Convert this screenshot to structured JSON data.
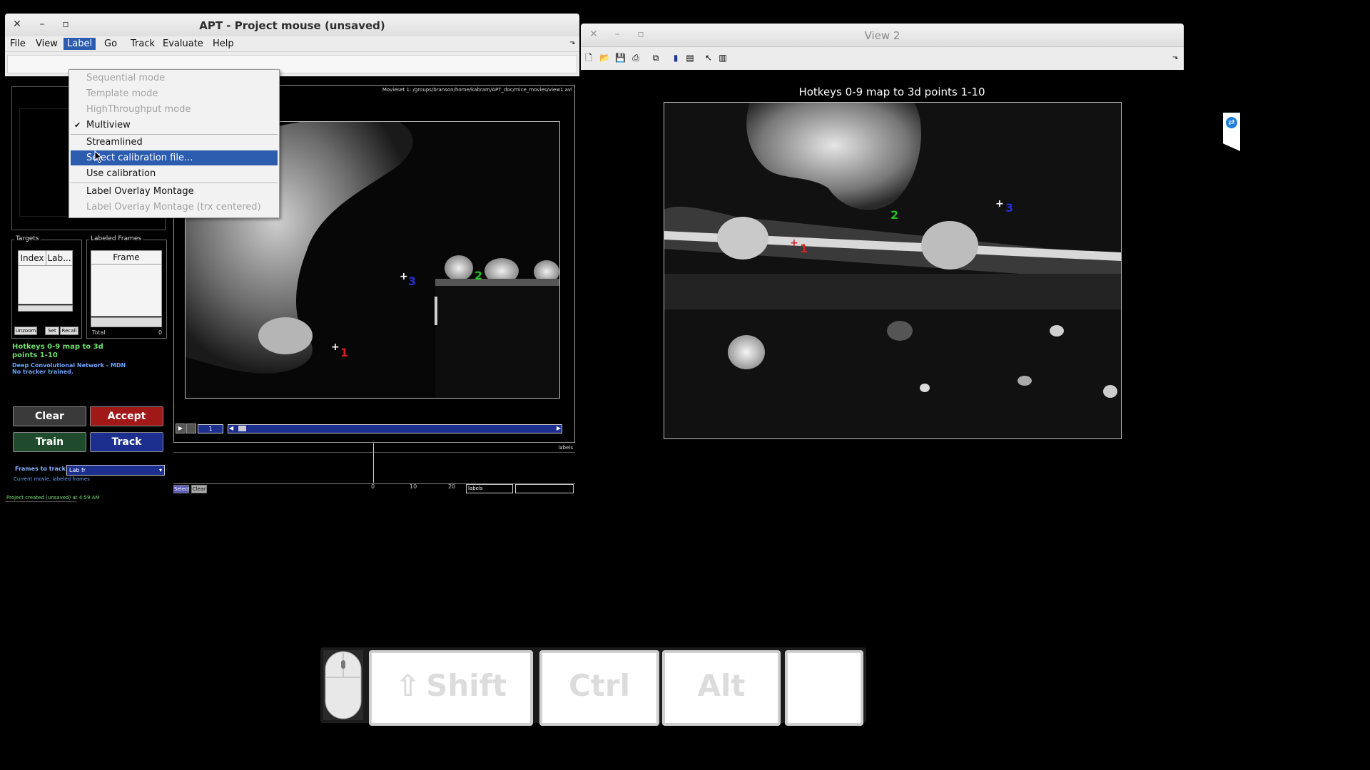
{
  "window1": {
    "title": "APT - Project mouse (unsaved)",
    "menu": [
      "File",
      "View",
      "Label",
      "Go",
      "Track",
      "Evaluate",
      "Help"
    ],
    "active_menu": "Label"
  },
  "label_menu": {
    "items": [
      {
        "label": "Sequential mode",
        "state": "disabled"
      },
      {
        "label": "Template mode",
        "state": "disabled"
      },
      {
        "label": "HighThroughput mode",
        "state": "disabled"
      },
      {
        "label": "Multiview",
        "state": "checked"
      },
      {
        "label": "Streamlined",
        "state": "normal"
      },
      {
        "label": "Select calibration file...",
        "state": "highlighted"
      },
      {
        "label": "Use calibration",
        "state": "normal"
      },
      {
        "label": "Label Overlay Montage",
        "state": "normal"
      },
      {
        "label": "Label Overlay Montage (trx centered)",
        "state": "disabled"
      }
    ],
    "checkmark": "✔"
  },
  "left_panel": {
    "targets_label": "Targets",
    "targets_columns": [
      "Index",
      "Lab..."
    ],
    "target_buttons": [
      "Unzoom",
      "Set",
      "Recall"
    ],
    "labeled_frames_label": "Labeled Frames",
    "labeled_frames_column": "Frame",
    "total_label": "Total",
    "total_value": "0",
    "hotkeys_text_line1": "Hotkeys 0-9 map to 3d",
    "hotkeys_text_line2": "points 1-10",
    "tracker_line1": "Deep Convolutional Network - MDN",
    "tracker_line2": "No tracker trained.",
    "buttons": {
      "clear": "Clear",
      "accept": "Accept",
      "train": "Train",
      "track": "Track"
    },
    "frames_to_track_label": "Frames to track:",
    "frames_to_track_value": "Lab fr",
    "frames_to_track_desc": "Current movie, labeled frames",
    "colors": {
      "clear": "#3a3a3a",
      "accept": "#a01818",
      "train": "#1f4a2b",
      "track": "#1c2f8f"
    }
  },
  "view1": {
    "movie_path": "Movieset 1: /groups/branson/home/kabram/APT_doc/mice_movies/view1.avi",
    "frame_value": "1",
    "landmarks": [
      {
        "num": "1",
        "color": "#d22020"
      },
      {
        "num": "2",
        "color": "#22c022"
      },
      {
        "num": "3",
        "color": "#2030c8"
      }
    ],
    "timeline_label": "labels",
    "timeline_ticks": [
      "0",
      "10",
      "20"
    ],
    "timeline_buttons": [
      "Select",
      "Clear"
    ],
    "timeline_dropdown": "labels",
    "status": "Project created (unsaved) at 4:59 AM"
  },
  "window2": {
    "title": "View 2",
    "axes_title": "Hotkeys 0-9 map to 3d points 1-10",
    "landmarks": [
      {
        "num": "1",
        "color": "#d22020"
      },
      {
        "num": "2",
        "color": "#22c022"
      },
      {
        "num": "3",
        "color": "#2030c8"
      }
    ]
  },
  "keyboard_overlay": {
    "keys": [
      "Shift",
      "Ctrl",
      "Alt",
      ""
    ]
  }
}
